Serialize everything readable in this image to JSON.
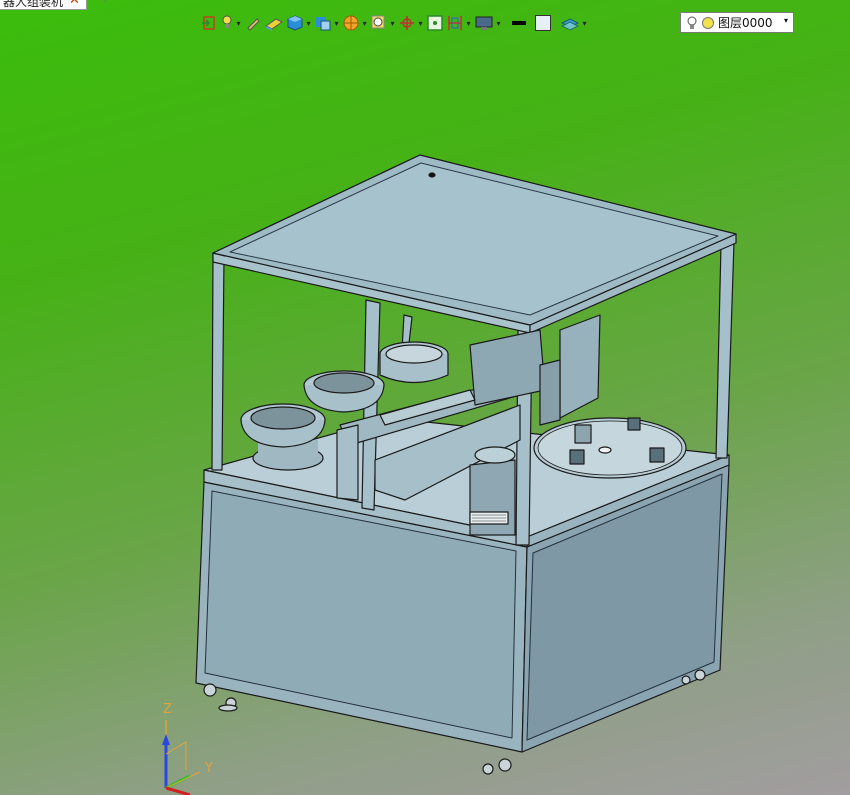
{
  "document_tab": {
    "title": "器人组装机",
    "close_glyph": "✕",
    "add_glyph": "+"
  },
  "toolbar": {
    "items": [
      {
        "name": "exit-sketch-icon",
        "dropdown": false
      },
      {
        "name": "light-bulb-icon",
        "dropdown": true
      },
      {
        "name": "pencil-icon",
        "dropdown": false
      },
      {
        "name": "eraser-icon",
        "dropdown": false
      },
      {
        "name": "solid-view-icon",
        "dropdown": true
      },
      {
        "name": "view-orientation-icon",
        "dropdown": true
      },
      {
        "name": "section-view-icon",
        "dropdown": true
      },
      {
        "name": "zoom-icon",
        "dropdown": true
      },
      {
        "name": "rotate-view-icon",
        "dropdown": true
      },
      {
        "name": "image-render-icon",
        "dropdown": false
      },
      {
        "name": "dimension-icon",
        "dropdown": true
      },
      {
        "name": "display-settings-icon",
        "dropdown": true
      },
      {
        "name": "line-color-icon",
        "dropdown": false
      },
      {
        "name": "fill-color-icon",
        "dropdown": false
      },
      {
        "name": "layer-manager-icon",
        "dropdown": true
      }
    ],
    "dropdown_glyph": "▾"
  },
  "layer_selector": {
    "value": "图层0000",
    "arrow": "▾"
  },
  "triad": {
    "z_label": "Z",
    "y_label": "Y"
  },
  "colors": {
    "bg_top": "#3bbd0c",
    "bg_bottom": "#a29da0",
    "machine_frame": "#9fbdc8",
    "machine_panel": "#8fa9b4",
    "outline": "#1a1a1a"
  }
}
